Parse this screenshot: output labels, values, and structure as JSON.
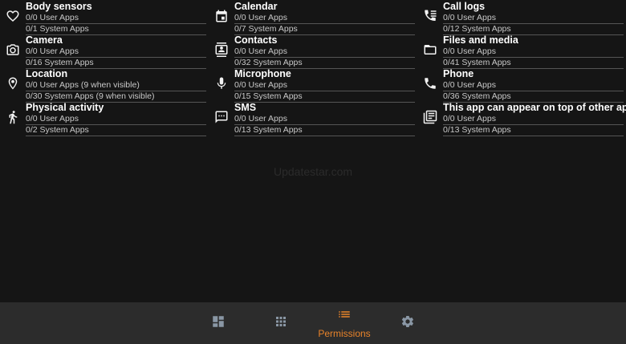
{
  "permissions": [
    {
      "title": "Body sensors",
      "user": "0/0 User Apps",
      "system": "0/1 System Apps",
      "icon": "heart-icon"
    },
    {
      "title": "Calendar",
      "user": "0/0 User Apps",
      "system": "0/7 System Apps",
      "icon": "calendar-icon"
    },
    {
      "title": "Call logs",
      "user": "0/0 User Apps",
      "system": "0/12 System Apps",
      "icon": "call-log-icon"
    },
    {
      "title": "Camera",
      "user": "0/0 User Apps",
      "system": "0/16 System Apps",
      "icon": "camera-icon"
    },
    {
      "title": "Contacts",
      "user": "0/0 User Apps",
      "system": "0/32 System Apps",
      "icon": "contacts-icon"
    },
    {
      "title": "Files and media",
      "user": "0/0 User Apps",
      "system": "0/41 System Apps",
      "icon": "folder-icon"
    },
    {
      "title": "Location",
      "user": "0/0 User Apps (9 when visible)",
      "system": "0/30 System Apps (9 when visible)",
      "icon": "location-pin-icon"
    },
    {
      "title": "Microphone",
      "user": "0/0 User Apps",
      "system": "0/15 System Apps",
      "icon": "microphone-icon"
    },
    {
      "title": "Phone",
      "user": "0/0 User Apps",
      "system": "0/36 System Apps",
      "icon": "phone-icon"
    },
    {
      "title": "Physical activity",
      "user": "0/0 User Apps",
      "system": "0/2 System Apps",
      "icon": "walking-icon"
    },
    {
      "title": "SMS",
      "user": "0/0 User Apps",
      "system": "0/13 System Apps",
      "icon": "sms-icon"
    },
    {
      "title": "This app can appear on top of other apps",
      "user": "0/0 User Apps",
      "system": "0/13 System Apps",
      "icon": "overlay-icon"
    }
  ],
  "watermark": "Updatestar.com",
  "bottom_nav": {
    "items": [
      {
        "icon": "dashboard-icon",
        "label": "",
        "active": false
      },
      {
        "icon": "apps-grid-icon",
        "label": "",
        "active": false
      },
      {
        "icon": "list-icon",
        "label": "Permissions",
        "active": true
      },
      {
        "icon": "gear-icon",
        "label": "",
        "active": false
      }
    ],
    "active_color": "#e8832a",
    "inactive_color": "#8a97a5"
  }
}
